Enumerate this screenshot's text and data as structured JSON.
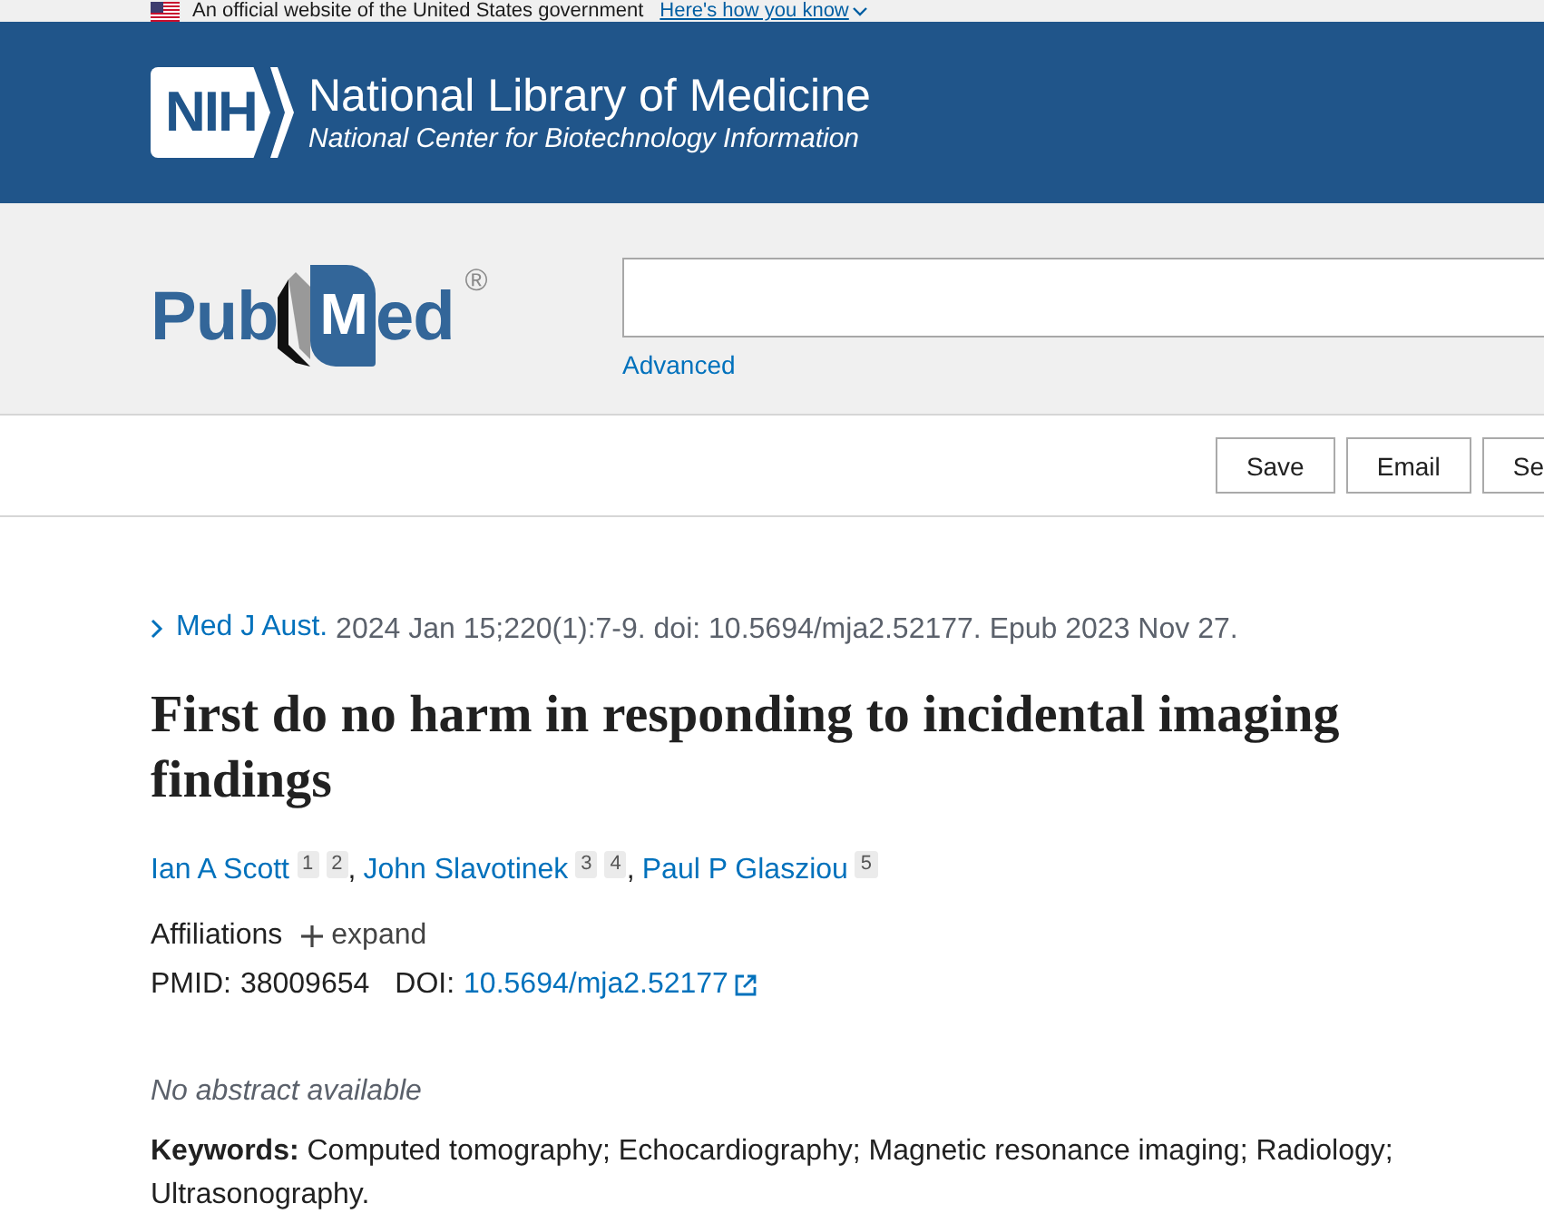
{
  "gov_banner": {
    "text": "An official website of the United States government",
    "link": "Here's how you know",
    "expanded": false
  },
  "header": {
    "logo": "NIH",
    "title": "National Library of Medicine",
    "subtitle": "National Center for Biotechnology Information"
  },
  "search": {
    "logo_parts": [
      "Pub",
      "M",
      "ed"
    ],
    "logo_mark": "®",
    "advanced_link": "Advanced"
  },
  "actions": [
    "Save",
    "Email",
    "Se"
  ],
  "article": {
    "journal": "Med J Aust.",
    "citation": "2024 Jan 15;220(1):7-9. doi: 10.5694/mja2.52177. Epub 2023 Nov 27.",
    "title": "First do no harm in responding to incidental imaging findings",
    "authors": [
      {
        "name": "Ian A Scott",
        "affiliations": [
          "1",
          "2"
        ],
        "separator": ","
      },
      {
        "name": "John Slavotinek",
        "affiliations": [
          "3",
          "4"
        ],
        "separator": ","
      },
      {
        "name": "Paul P Glasziou",
        "affiliations": [
          "5"
        ]
      }
    ],
    "affiliations": {
      "label": "Affiliations",
      "toggle": "expand",
      "expanded": false
    },
    "identifiers": [
      {
        "kind": "text",
        "label": "PMID:",
        "value": "38009654"
      },
      {
        "kind": "link",
        "label": "DOI:",
        "value": "10.5694/mja2.52177"
      }
    ],
    "abstract_note": "No abstract available",
    "keywords": "**Keywords:** Computed tomography; Echocardiography; Magnetic resonance imaging; Radiology; Ultrasonography."
  }
}
